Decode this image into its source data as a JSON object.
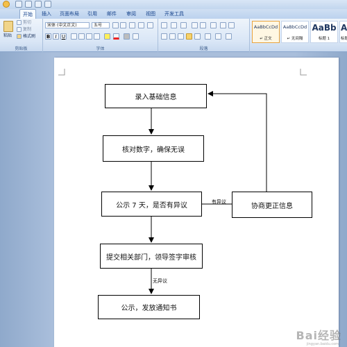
{
  "ribbon_tabs": [
    "开始",
    "插入",
    "页面布局",
    "引用",
    "邮件",
    "审阅",
    "视图",
    "开发工具"
  ],
  "clipboard": {
    "paste": "粘贴",
    "cut": "剪切",
    "copy": "复制",
    "format_painter": "格式刷",
    "group_label": "剪贴板"
  },
  "font": {
    "name": "宋体 (中文正文)",
    "size": "五号",
    "group_label": "字体"
  },
  "paragraph": {
    "group_label": "段落"
  },
  "styles": [
    {
      "sample": "AaBbCcDd",
      "name": "↵ 正文"
    },
    {
      "sample": "AaBbCcDd",
      "name": "↵ 无间隔"
    },
    {
      "sample": "AaBb",
      "name": "标题 1"
    },
    {
      "sample": "AaB",
      "name": "标题 2"
    }
  ],
  "flowchart": {
    "step1": "录入基础信息",
    "step2": "核对数字，确保无误",
    "step3": "公示 7 天，是否有异议",
    "step4": "协商更正信息",
    "step5": "提交相关部门，领导签字审核",
    "step6": "公示，发放通知书",
    "label_yes": "有异议",
    "label_no": "无异议"
  },
  "watermark": {
    "text": "Bai经验",
    "sub": "jingyan.baidu.com"
  }
}
